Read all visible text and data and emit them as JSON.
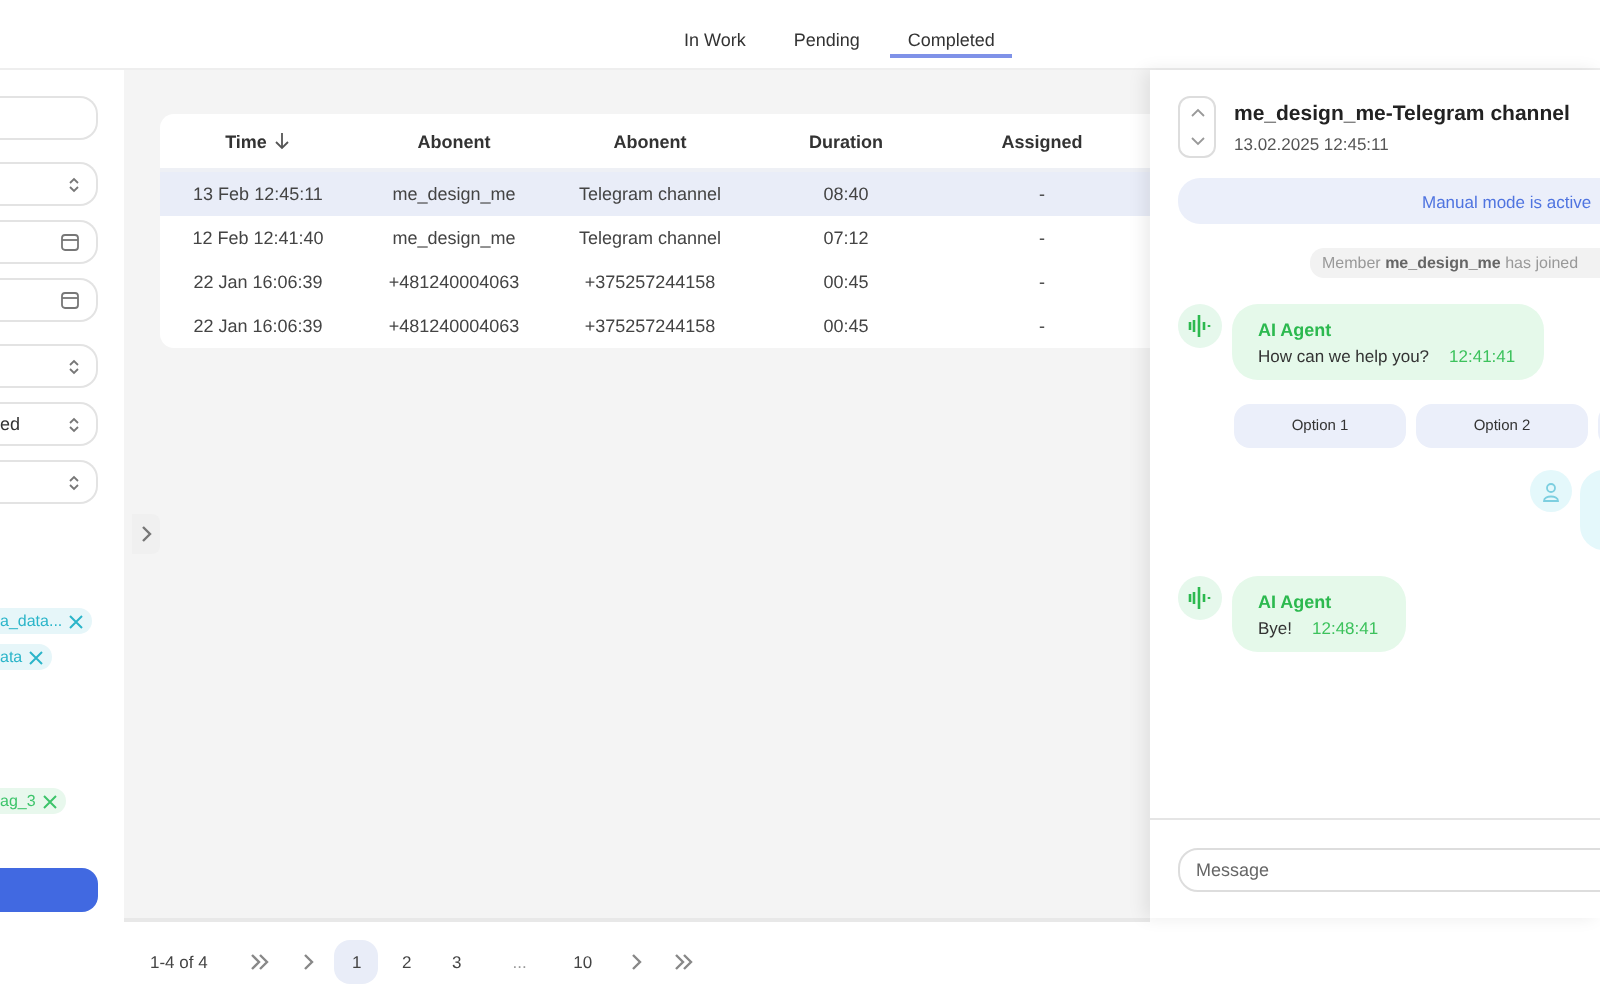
{
  "tabs": [
    {
      "label": "In Work",
      "selected": false
    },
    {
      "label": "Pending",
      "selected": false
    },
    {
      "label": "Completed",
      "selected": true
    }
  ],
  "sidebar": {
    "fields": [
      {
        "kind": "text"
      },
      {
        "kind": "select"
      },
      {
        "kind": "date"
      },
      {
        "kind": "date"
      },
      {
        "kind": "select"
      },
      {
        "kind": "select",
        "value": "ed"
      },
      {
        "kind": "select"
      }
    ],
    "tag_groups": [
      [
        {
          "label": "a_data...",
          "color": "#2bb5c9"
        },
        {
          "label": "ata",
          "color": "#2bb5c9"
        }
      ],
      [
        {
          "label": "ag_3",
          "color": "#3cc46a"
        }
      ]
    ]
  },
  "table": {
    "columns": [
      {
        "label": "Time",
        "sorted": true
      },
      {
        "label": "Abonent",
        "sorted": false
      },
      {
        "label": "Abonent",
        "sorted": false
      },
      {
        "label": "Duration",
        "sorted": false
      },
      {
        "label": "Assigned",
        "sorted": false
      }
    ],
    "rows": [
      {
        "selected": true,
        "cells": [
          "13 Feb 12:45:11",
          "me_design_me",
          "Telegram channel",
          "08:40",
          "-"
        ]
      },
      {
        "selected": false,
        "cells": [
          "12 Feb 12:41:40",
          "me_design_me",
          "Telegram channel",
          "07:12",
          "-"
        ]
      },
      {
        "selected": false,
        "cells": [
          "22 Jan 16:06:39",
          "+481240004063",
          "+375257244158",
          "00:45",
          "-"
        ]
      },
      {
        "selected": false,
        "cells": [
          "22 Jan 16:06:39",
          "+481240004063",
          "+375257244158",
          "00:45",
          "-"
        ]
      }
    ]
  },
  "chat": {
    "title": "me_design_me-Telegram channel",
    "date": "13.02.2025 12:45:11",
    "banner": "Manual mode is active",
    "messages": [
      {
        "kind": "system",
        "text": "Member **me_design_me** has joined"
      },
      {
        "kind": "agent",
        "sender": "AI Agent",
        "text": "How can we help you?",
        "time": "12:41:41"
      },
      {
        "kind": "options",
        "options": [
          {
            "kind": "labeled",
            "label": "Option 1"
          },
          {
            "kind": "labeled",
            "label": "Option 2"
          },
          {
            "kind": "clipped"
          }
        ]
      },
      {
        "kind": "user"
      },
      {
        "kind": "agent",
        "sender": "AI Agent",
        "text": "Bye!",
        "time": "12:48:41"
      }
    ],
    "composer": {
      "placeholder": "Message"
    }
  },
  "pagination": {
    "range": "1-4 of 4",
    "pages": [
      {
        "label": "1",
        "selected": true
      },
      {
        "label": "2",
        "selected": false
      },
      {
        "label": "3",
        "selected": false
      },
      {
        "label": "...",
        "selected": false
      },
      {
        "label": "10",
        "selected": false
      }
    ]
  }
}
